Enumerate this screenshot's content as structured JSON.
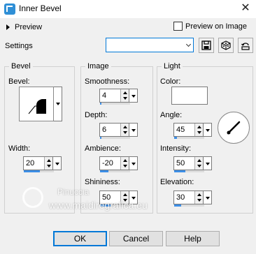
{
  "window": {
    "title": "Inner Bevel",
    "close_glyph": "✕"
  },
  "top": {
    "preview_label": "Preview",
    "preview_on_image_label": "Preview on Image",
    "preview_on_image_checked": false
  },
  "settings": {
    "label": "Settings",
    "preset_value": ""
  },
  "bevel": {
    "title": "Bevel",
    "bevel_label": "Bevel:",
    "width_label": "Width:",
    "width_value": "20",
    "width_fraction": 0.75
  },
  "image": {
    "title": "Image",
    "smoothness_label": "Smoothness:",
    "smoothness_value": "4",
    "smoothness_fraction": 0.05,
    "depth_label": "Depth:",
    "depth_value": "6",
    "depth_fraction": 0.05,
    "ambience_label": "Ambience:",
    "ambience_value": "-20",
    "ambience_fraction": 0.4,
    "shininess_label": "Shininess:",
    "shininess_value": "50",
    "shininess_fraction": 0.5
  },
  "light": {
    "title": "Light",
    "color_label": "Color:",
    "color_value": "#ffffff",
    "angle_label": "Angle:",
    "angle_value": "45",
    "angle_fraction": 0.12,
    "intensity_label": "Intensity:",
    "intensity_value": "50",
    "intensity_fraction": 0.5,
    "elevation_label": "Elevation:",
    "elevation_value": "30",
    "elevation_fraction": 0.33
  },
  "buttons": {
    "ok": "OK",
    "cancel": "Cancel",
    "help": "Help"
  },
  "watermark": {
    "name": "Pinuccia",
    "site": "www.maidiregrafica.eu"
  },
  "colors": {
    "accent": "#0078d7",
    "bar": "#3c8ee6",
    "app_icon": "#2f8fd6"
  }
}
